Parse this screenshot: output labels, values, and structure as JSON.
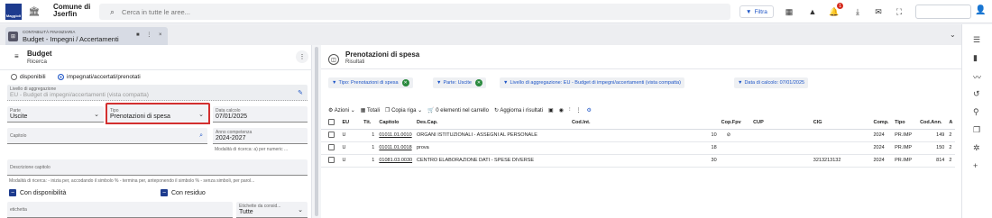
{
  "topbar": {
    "logo_text": "Maggioli",
    "org_name_line1": "Comune di",
    "org_name_line2": "Jserfin",
    "search_placeholder": "Cerca in tutte le aree...",
    "filter_label": "Filtra",
    "notification_count": "1"
  },
  "tab": {
    "context": "CONTABILITÀ FINANZIARIA",
    "title": "Budget - Impegni / Accertamenti",
    "actions": "■ ⋮ ×"
  },
  "left": {
    "title": "Budget",
    "subtitle": "Ricerca",
    "radio_options": [
      "disponibili",
      "impegnati/accertati/prenotati"
    ],
    "radio_selected": "impegnati/accertati/prenotati",
    "livello_label": "Livello di aggregazione",
    "livello_value": "EU - Budget di impegni/accertamenti (vista compatta)",
    "parte_label": "Parte",
    "parte_value": "Uscite",
    "tipo_label": "Tipo",
    "tipo_value": "Prenotazioni di spesa",
    "data_label": "Data calcolo",
    "data_value": "07/01/2025",
    "capitolo_label": "Capitolo",
    "anno_label": "Anno competenza",
    "anno_value": "2024-2027",
    "anno_hint": "Modalità di ricerca: a) per numeric ...",
    "descr_label": "Descrizione capitolo",
    "descr_hint": "Modalità di ricerca: - inizia per, accodando il simbolo % - termina per, anteponendo il simbolo % - senza simboli, per parol...",
    "con_disponibilita": "Con disponibilità",
    "con_residuo": "Con residuo",
    "etichetta_label": "etichetta",
    "etichette_cons_label": "Etichette da consid...",
    "etichette_cons_value": "Tutte"
  },
  "right": {
    "title": "Prenotazioni di spesa",
    "subtitle": "Risultati",
    "chips": [
      "Tipo: Prenotazioni di spesa",
      "Parte: Uscite",
      "Livello di aggregazione: EU - Budget di impegni/accertamenti (vista compatta)",
      "Data di calcolo: 07/01/2025"
    ],
    "toolbar": {
      "azioni": "Azioni",
      "totali": "Totali",
      "copia_riga": "Copia riga",
      "carrello": "0 elementi nel carrello",
      "aggiorna": "Aggiorna i risultati"
    },
    "columns": [
      "EU",
      "Tit.",
      "Capitolo",
      "Des.Cap.",
      "Cod.Int.",
      "Cop.Fpv",
      "CUP",
      "CIG",
      "Comp.",
      "Tipo",
      "Cod.Ann.",
      "A"
    ],
    "rows": [
      {
        "eu": "U",
        "tit": "1",
        "capitolo": "01011.01.0010",
        "descr": "ORGANI ISTITUZIONALI - ASSEGNI AL PERSONALE",
        "codint": "10",
        "copfpv": "⊘",
        "cup": "",
        "cig": "",
        "comp": "2024",
        "tipo": "PR.IMP",
        "codann": "149",
        "a": "2"
      },
      {
        "eu": "U",
        "tit": "1",
        "capitolo": "01011.01.0018",
        "descr": "prova",
        "codint": "18",
        "copfpv": "",
        "cup": "",
        "cig": "",
        "comp": "2024",
        "tipo": "PR.IMP",
        "codann": "150",
        "a": "2"
      },
      {
        "eu": "U",
        "tit": "1",
        "capitolo": "01081.03.0030",
        "descr": "CENTRO ELABORAZIONE DATI - SPESE DIVERSE",
        "codint": "30",
        "copfpv": "",
        "cup": "",
        "cig": "3213213132",
        "comp": "2024",
        "tipo": "PR.IMP",
        "codann": "814",
        "a": "2"
      }
    ]
  }
}
